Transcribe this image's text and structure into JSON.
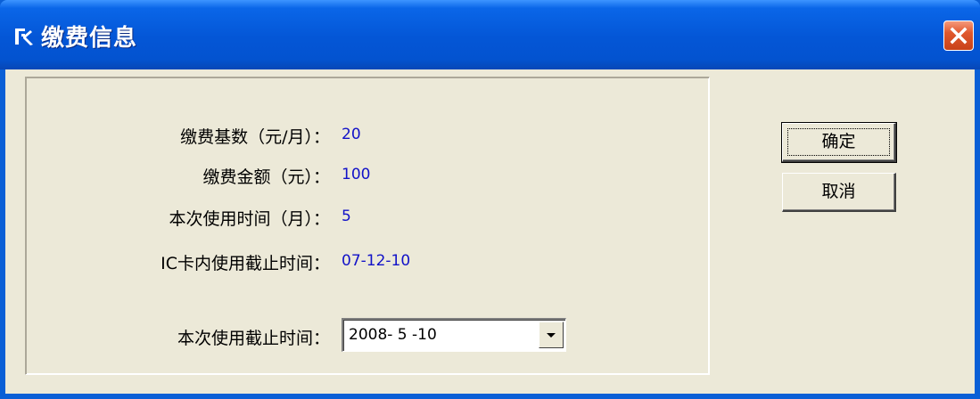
{
  "window": {
    "title": "缴费信息",
    "app_icon": "app-logo-icon",
    "close_icon": "close-icon"
  },
  "form": {
    "fields": [
      {
        "label": "缴费基数（元/月）：",
        "value": "20"
      },
      {
        "label": "缴费金额（元）：",
        "value": "100"
      },
      {
        "label": "本次使用时间（月）：",
        "value": "5"
      },
      {
        "label": "IC卡内使用截止时间：",
        "value": "07-12-10"
      }
    ],
    "deadline_label": "本次使用截止时间：",
    "deadline_value": "2008- 5 -10"
  },
  "buttons": {
    "ok": "确定",
    "cancel": "取消"
  },
  "colors": {
    "titlebar": "#0456d6",
    "value_text": "#1212c8",
    "face": "#ece9d8",
    "close": "#e0582d"
  }
}
